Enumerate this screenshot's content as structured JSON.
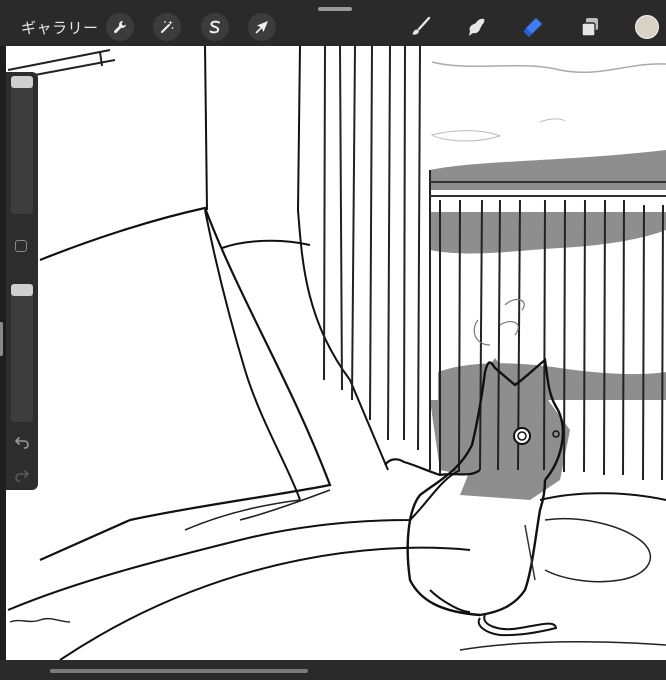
{
  "toolbar": {
    "gallery_label": "ギャラリー",
    "actions_icon": "wrench-icon",
    "adjustments_icon": "magic-wand-icon",
    "selection_icon": "selection-s-icon",
    "transform_icon": "arrow-cursor-icon",
    "brush_icon": "brush-icon",
    "smudge_icon": "smudge-finger-icon",
    "eraser_icon": "eraser-icon",
    "layers_icon": "layers-icon",
    "color_swatch": "#d8d2c4",
    "active_tool": "eraser",
    "active_color": "#3d7bf5"
  },
  "sidebar": {
    "brush_size_level": 0.0,
    "opacity_level": 0.0,
    "undo_icon": "undo-icon",
    "redo_icon": "redo-icon"
  }
}
